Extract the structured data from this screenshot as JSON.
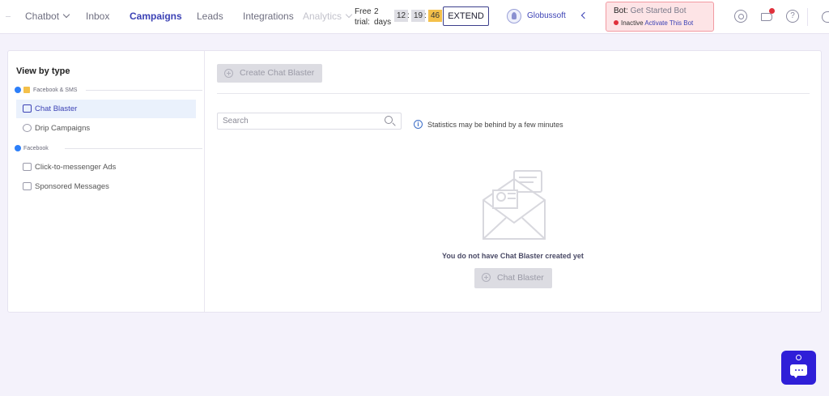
{
  "nav": {
    "items": [
      {
        "label": "Chatbot"
      },
      {
        "label": "Inbox"
      },
      {
        "label": "Campaigns"
      },
      {
        "label": "Leads"
      },
      {
        "label": "Integrations"
      },
      {
        "label": "Analytics"
      }
    ],
    "active": "Campaigns"
  },
  "trial": {
    "line1": "Free",
    "line2": "trial:",
    "days_count": "2",
    "days_label": "days",
    "hours": "12",
    "minutes": "19",
    "seconds": "46",
    "extend_label": "EXTEND"
  },
  "account": {
    "name": "Globussoft"
  },
  "bot": {
    "prefix": "Bot:",
    "name": "Get Started Bot",
    "status": "Inactive",
    "activate_label": "Activate This Bot",
    "status_color": "#e0303b"
  },
  "sidebar": {
    "title": "View by type",
    "groups": [
      {
        "label": "Facebook & SMS",
        "items": [
          {
            "label": "Chat Blaster",
            "icon": "chat-blaster-icon",
            "active": true
          },
          {
            "label": "Drip Campaigns",
            "icon": "drip-icon",
            "active": false
          }
        ]
      },
      {
        "label": "Facebook",
        "items": [
          {
            "label": "Click-to-messenger Ads",
            "icon": "ads-icon",
            "active": false
          },
          {
            "label": "Sponsored Messages",
            "icon": "sponsored-icon",
            "active": false
          }
        ]
      }
    ]
  },
  "main": {
    "create_label": "Create Chat Blaster",
    "search_placeholder": "Search",
    "stats_note": "Statistics may be behind by a few minutes",
    "empty_text": "You do not have Chat Blaster created yet",
    "empty_button_label": "Chat Blaster"
  },
  "colors": {
    "accent": "#3c42b5",
    "launcher": "#2f1fd8",
    "timer_highlight": "#f4c04a"
  }
}
